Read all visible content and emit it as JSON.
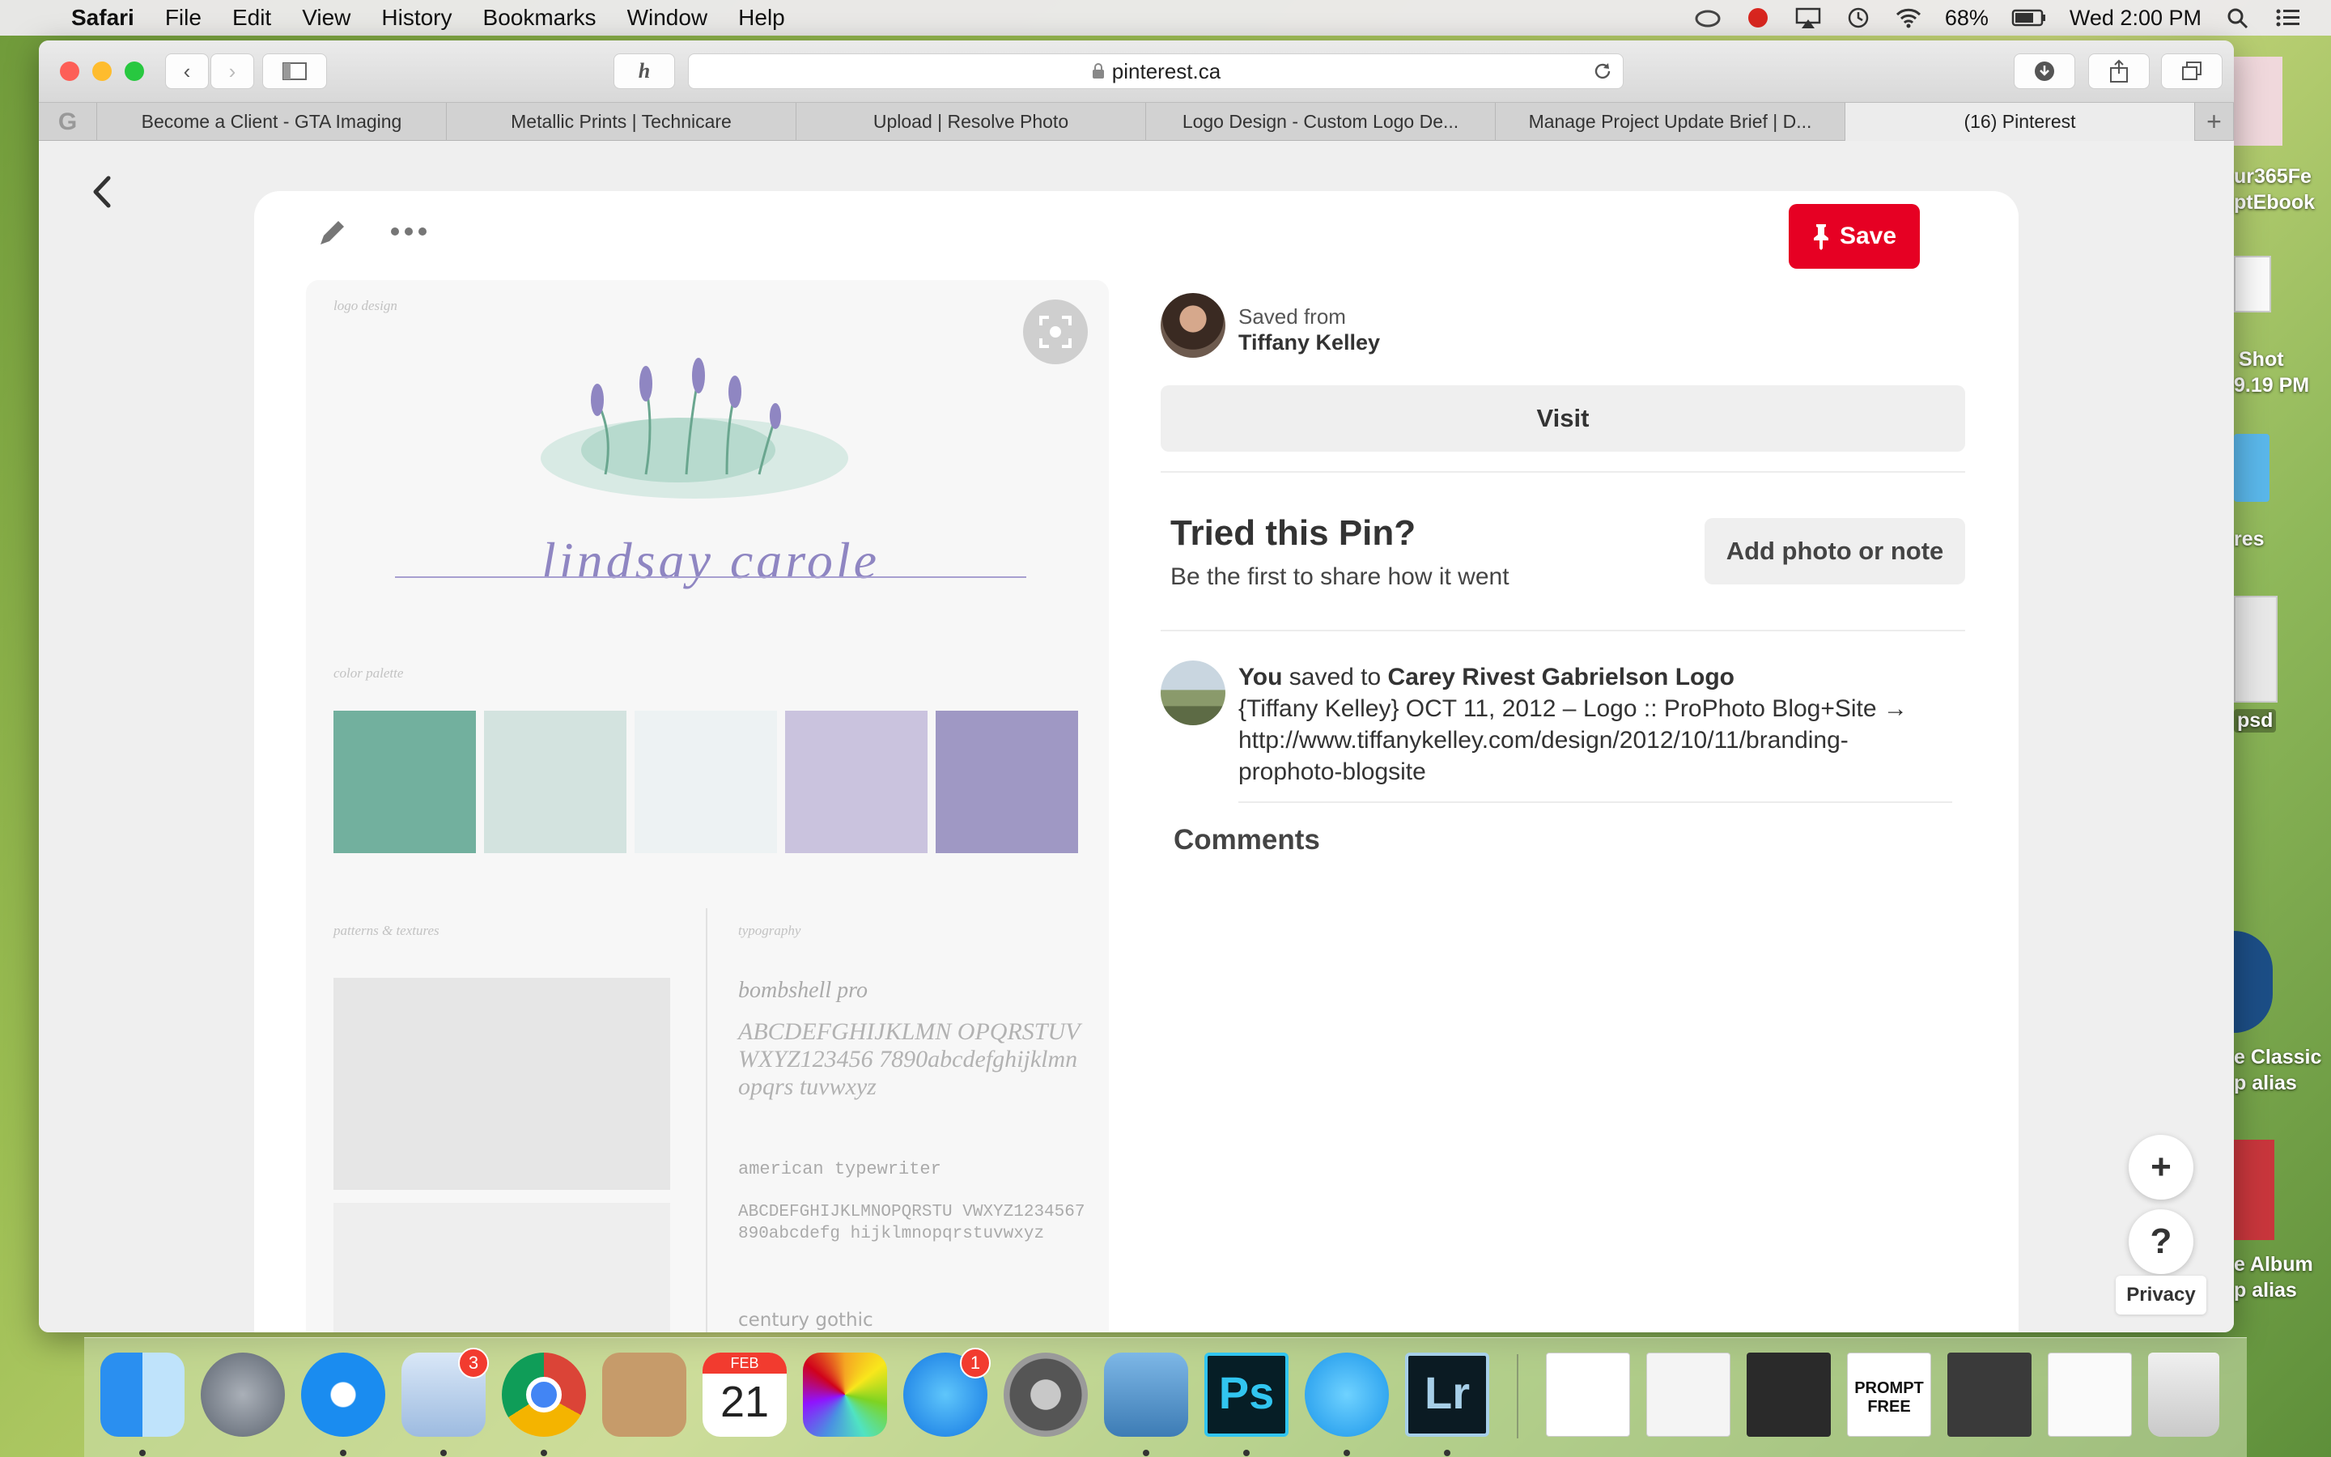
{
  "menubar": {
    "app": "Safari",
    "items": [
      "File",
      "Edit",
      "View",
      "History",
      "Bookmarks",
      "Window",
      "Help"
    ],
    "battery": "68%",
    "clock": "Wed 2:00 PM"
  },
  "browser": {
    "url": "pinterest.ca",
    "tabs": [
      "Become a Client - GTA Imaging",
      "Metallic Prints | Technicare",
      "Upload | Resolve Photo",
      "Logo Design - Custom Logo De...",
      "Manage Project Update Brief | D...",
      "(16) Pinterest"
    ],
    "active_tab": 5
  },
  "pin": {
    "save_label": "Save",
    "saved_from_label": "Saved from",
    "saved_from_name": "Tiffany Kelley",
    "visit_label": "Visit",
    "tried_title": "Tried this Pin?",
    "tried_sub": "Be the first to share how it went",
    "add_photo_label": "Add photo or note",
    "you_label": "You",
    "saved_to_label": "saved to",
    "board": "Carey Rivest Gabrielson Logo",
    "description": "{Tiffany Kelley} OCT 11, 2012 – Logo :: ProPhoto Blog+Site → http://www.tiffanykelley.com/design/2012/10/11/branding-prophoto-blogsite",
    "comments_label": "Comments"
  },
  "image": {
    "label_logo": "logo design",
    "logo_text": "lindsay carole",
    "label_palette": "color palette",
    "palette": [
      "#72b09e",
      "#d3e3df",
      "#edf2f3",
      "#cac3de",
      "#9f98c4"
    ],
    "label_patterns": "patterns & textures",
    "label_typography": "typography",
    "font1": "bombshell pro",
    "font1_sample": "ABCDEFGHIJKLMN OPQRSTUVWXYZ123456 7890abcdefghijklmnopqrs tuvwxyz",
    "font2": "american typewriter",
    "font2_sample": "ABCDEFGHIJKLMNOPQRSTU VWXYZ1234567890abcdefg hijklmnopqrstuvwxyz",
    "font3": "century gothic"
  },
  "floating": {
    "privacy": "Privacy"
  },
  "desktop": {
    "items": [
      "ur365Fe",
      "ptEbook",
      "Shot",
      "9.19 PM",
      "res",
      "psd",
      "e Classic",
      "p alias",
      "e Album",
      "p alias"
    ]
  },
  "dock": {
    "mail_badge": "3",
    "calendar_month": "FEB",
    "calendar_day": "21",
    "appstore_badge": "1",
    "ps": "Ps",
    "lr": "Lr",
    "prompt": "PROMPT FREE"
  }
}
